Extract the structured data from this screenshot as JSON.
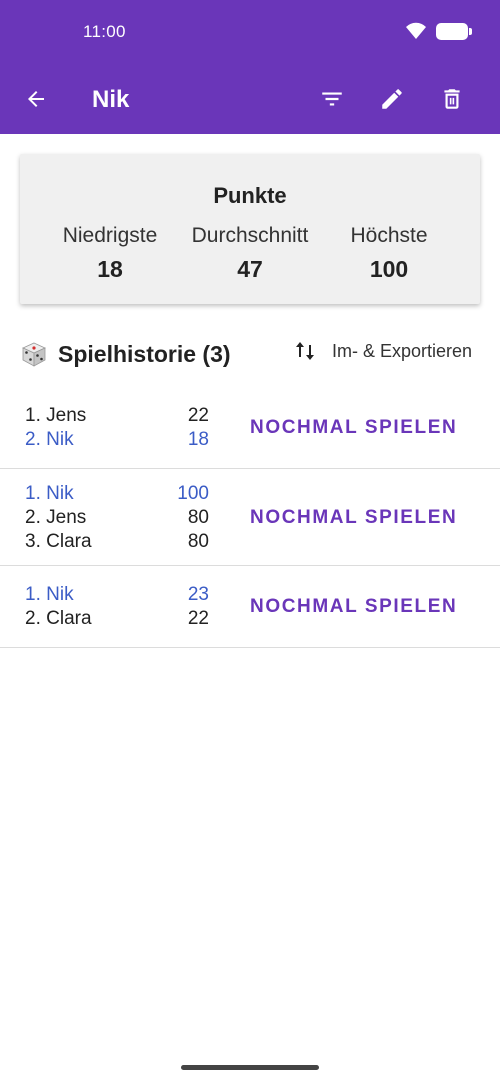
{
  "status_bar": {
    "time": "11:00"
  },
  "toolbar": {
    "title": "Nik",
    "back_icon": "arrow-back-icon",
    "actions": [
      "filter-icon",
      "edit-icon",
      "delete-icon"
    ]
  },
  "stats": {
    "title": "Punkte",
    "lowest": {
      "label": "Niedrigste",
      "value": "18"
    },
    "average": {
      "label": "Durchschnitt",
      "value": "47"
    },
    "highest": {
      "label": "Höchste",
      "value": "100"
    }
  },
  "history": {
    "title": "Spielhistorie (3)",
    "import_export_label": "Im- & Exportieren",
    "games": [
      {
        "players": [
          {
            "rank": "1. Jens",
            "score": "22",
            "highlight": false
          },
          {
            "rank": "2. Nik",
            "score": "18",
            "highlight": true
          }
        ],
        "replay_label": "NOCHMAL SPIELEN"
      },
      {
        "players": [
          {
            "rank": "1. Nik",
            "score": "100",
            "highlight": true
          },
          {
            "rank": "2. Jens",
            "score": "80",
            "highlight": false
          },
          {
            "rank": "3. Clara",
            "score": "80",
            "highlight": false
          }
        ],
        "replay_label": "NOCHMAL SPIELEN"
      },
      {
        "players": [
          {
            "rank": "1. Nik",
            "score": "23",
            "highlight": true
          },
          {
            "rank": "2. Clara",
            "score": "22",
            "highlight": false
          }
        ],
        "replay_label": "NOCHMAL SPIELEN"
      }
    ]
  },
  "colors": {
    "primary": "#6a36b9",
    "highlight": "#3b5cc6"
  }
}
